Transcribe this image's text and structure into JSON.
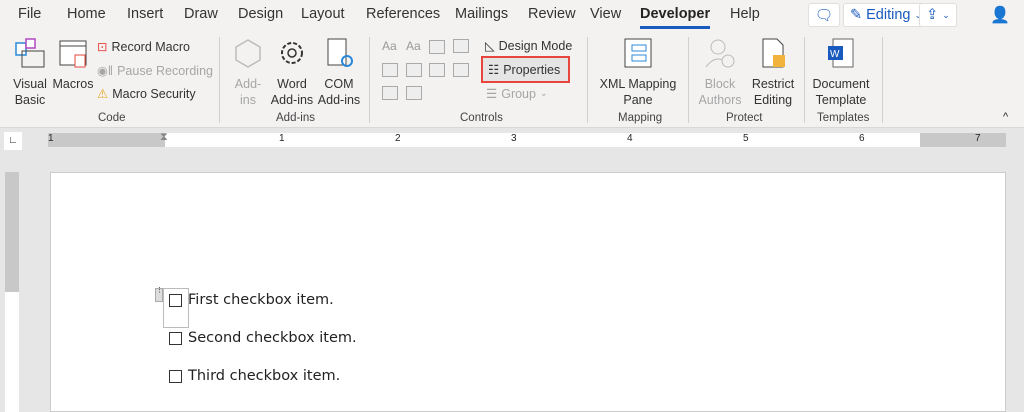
{
  "tabs": [
    "File",
    "Home",
    "Insert",
    "Draw",
    "Design",
    "Layout",
    "References",
    "Mailings",
    "Review",
    "View",
    "Developer",
    "Help"
  ],
  "active_tab": "Developer",
  "top_right": {
    "editing_label": "Editing"
  },
  "ribbon": {
    "code": {
      "visual_basic": [
        "Visual",
        "Basic"
      ],
      "macros": "Macros",
      "record_macro": "Record Macro",
      "pause_recording": "Pause Recording",
      "macro_security": "Macro Security",
      "label": "Code"
    },
    "addins": {
      "addins": [
        "Add-",
        "ins"
      ],
      "word_addins": [
        "Word",
        "Add-ins"
      ],
      "com_addins": [
        "COM",
        "Add-ins"
      ],
      "label": "Add-ins"
    },
    "controls": {
      "design_mode": "Design Mode",
      "properties": "Properties",
      "group": "Group",
      "label": "Controls"
    },
    "mapping": {
      "xml": [
        "XML Mapping",
        "Pane"
      ],
      "label": "Mapping"
    },
    "protect": {
      "block": [
        "Block",
        "Authors"
      ],
      "restrict": [
        "Restrict",
        "Editing"
      ],
      "label": "Protect"
    },
    "templates": {
      "doc": [
        "Document",
        "Template"
      ],
      "label": "Templates"
    }
  },
  "ruler": {
    "numbers": [
      "1",
      "1",
      "2",
      "3",
      "4",
      "5",
      "6",
      "7"
    ]
  },
  "document": {
    "items": [
      "First checkbox item.",
      "Second checkbox item.",
      "Third checkbox item."
    ]
  },
  "colors": {
    "accent": "#185abd",
    "highlight": "#e8453c"
  }
}
